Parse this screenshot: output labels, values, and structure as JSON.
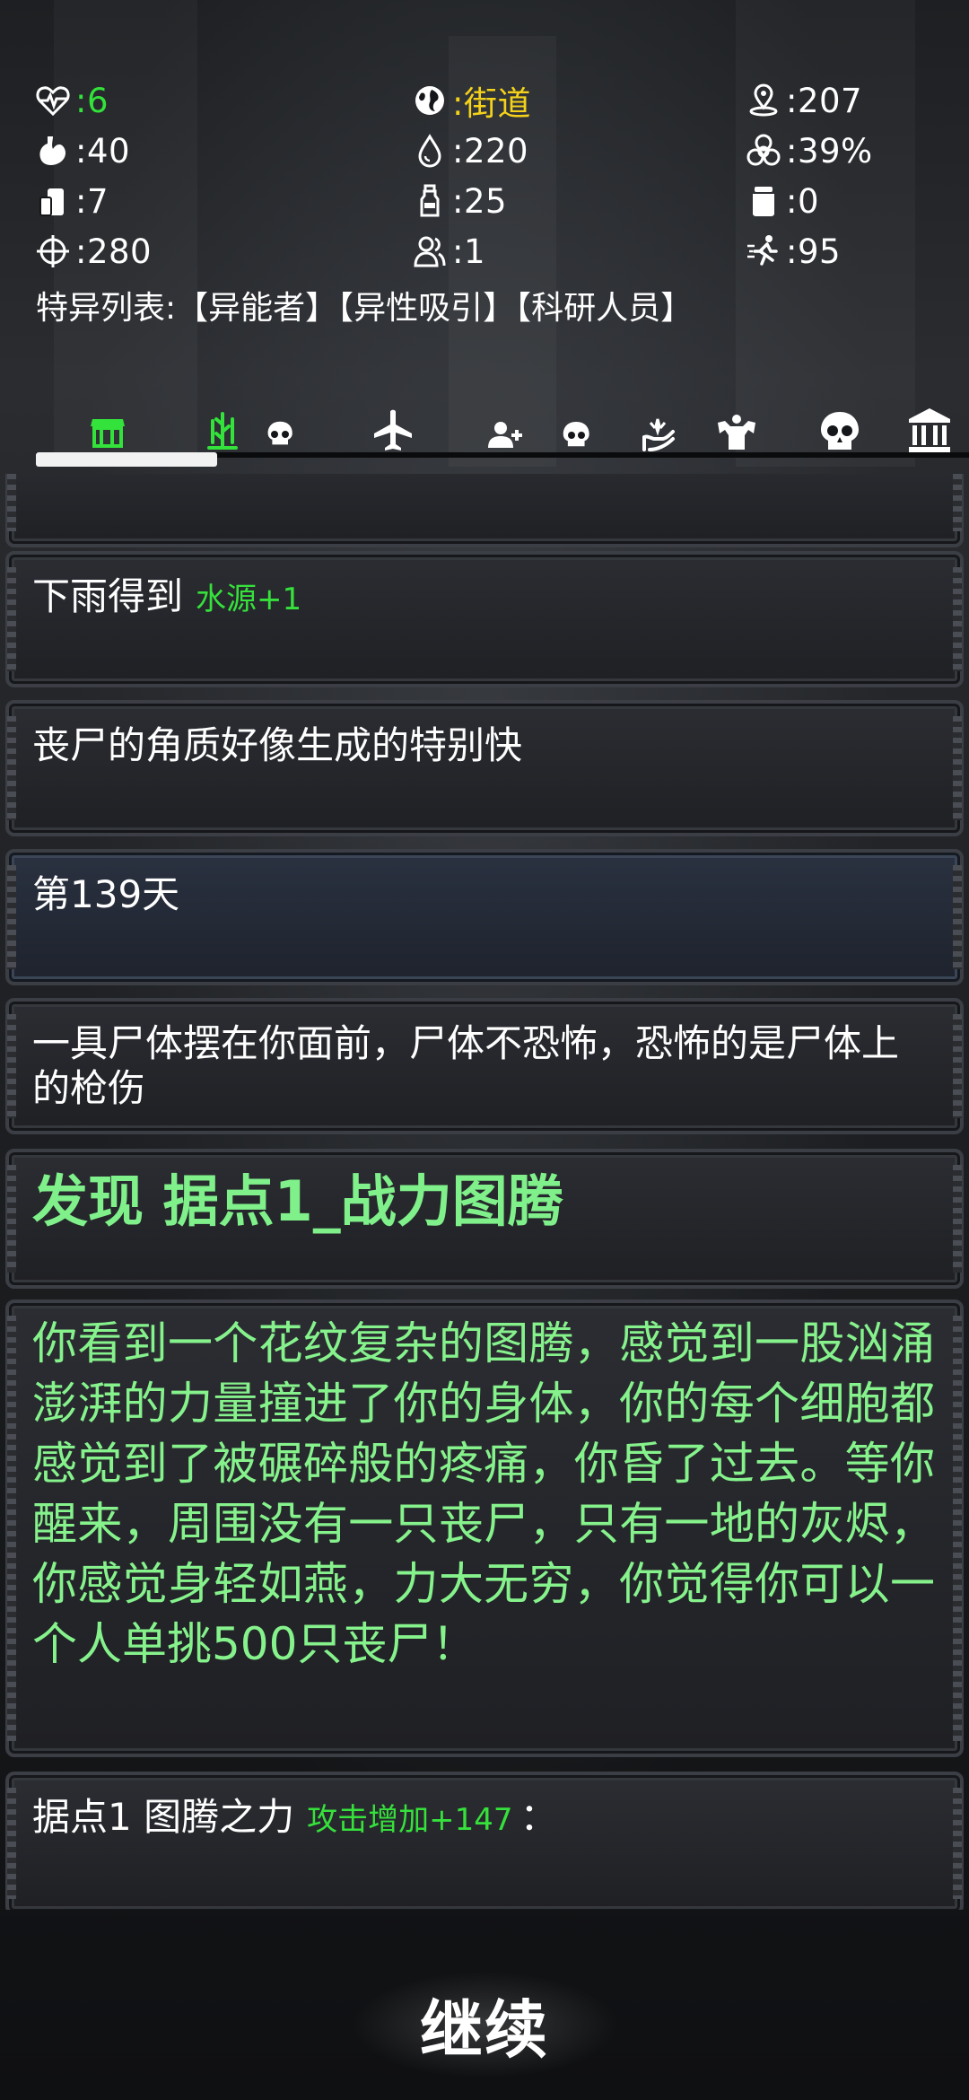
{
  "stats": {
    "health": {
      "icon": "heart-pulse-icon",
      "value": ":6"
    },
    "location": {
      "icon": "globe-icon",
      "value": ":街道"
    },
    "distance": {
      "icon": "map-pin-icon",
      "value": ":207"
    },
    "hunger": {
      "icon": "stomach-icon",
      "value": ":40"
    },
    "water": {
      "icon": "water-drop-icon",
      "value": ":220"
    },
    "infection": {
      "icon": "biohazard-icon",
      "value": ":39%"
    },
    "food": {
      "icon": "food-can-icon",
      "value": ":7"
    },
    "bottle": {
      "icon": "bottle-icon",
      "value": ":25"
    },
    "jar": {
      "icon": "jar-icon",
      "value": ":0"
    },
    "attack": {
      "icon": "crosshair-icon",
      "value": ":280"
    },
    "people": {
      "icon": "people-icon",
      "value": ":1"
    },
    "speed": {
      "icon": "running-man-icon",
      "value": ":95"
    }
  },
  "traits": "特异列表:【异能者】【异性吸引】【科研人员】",
  "tabs": [
    {
      "name": "tab-shop",
      "icon": "shop-icon",
      "active": true
    },
    {
      "name": "tab-plant",
      "icon": "plant-icon",
      "active": false
    },
    {
      "name": "tab-zombie",
      "icon": "skull-icon",
      "active": false
    },
    {
      "name": "tab-travel",
      "icon": "airplane-icon",
      "active": false
    },
    {
      "name": "tab-recruit",
      "icon": "add-user-icon",
      "active": false
    },
    {
      "name": "tab-horde",
      "icon": "skull-icon",
      "active": false
    },
    {
      "name": "tab-skills",
      "icon": "hand-sparkle-icon",
      "active": false
    },
    {
      "name": "tab-strength",
      "icon": "muscle-icon",
      "active": false
    },
    {
      "name": "tab-boss",
      "icon": "skull-icon",
      "active": false
    },
    {
      "name": "tab-bank",
      "icon": "bank-icon",
      "active": false
    }
  ],
  "log": {
    "rain": {
      "text": "下雨得到",
      "reward": "水源+1"
    },
    "zombie_horns": "丧尸的角质好像生成的特别快",
    "day": "第139天",
    "corpse": "一具尸体摆在你面前，尸体不恐怖，恐怖的是尸体上的枪伤",
    "discover": "发现 据点1_战力图腾",
    "totem_story": "你看到一个花纹复杂的图腾，感觉到一股汹涌澎湃的力量撞进了你的身体，你的每个细胞都感觉到了被碾碎般的疼痛，你昏了过去。等你醒来，周围没有一只丧尸，只有一地的灰烬，你感觉身轻如燕，力大无穷，你觉得你可以一个人单挑500只丧尸！",
    "totem_power": {
      "text": "据点1 图腾之力",
      "reward": "攻击增加+147",
      "suffix": "："
    }
  },
  "continue_label": "继续",
  "colors": {
    "accent_green": "#33e23a",
    "story_green": "#86f28c",
    "location_yellow": "#f4d21a"
  }
}
